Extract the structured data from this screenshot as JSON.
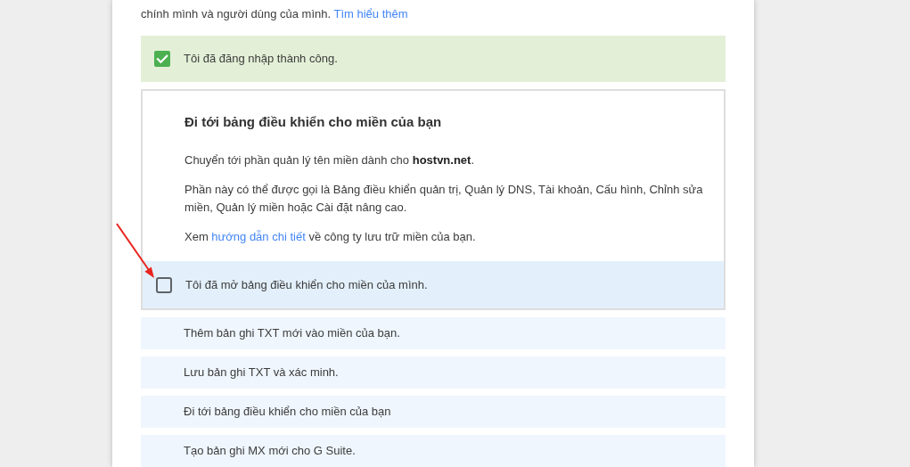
{
  "intro": {
    "text": "chính mình và người dùng của mình.",
    "link": "Tìm hiểu thêm"
  },
  "steps": [
    {
      "kind": "confirm",
      "label": "Tôi đã đăng nhập thành công.",
      "checked": true
    },
    {
      "kind": "expanded",
      "title": "Đi tới bảng điều khiển cho miền của bạn",
      "paragraphs": [
        {
          "text": "Chuyển tới phần quản lý tên miền dành cho **hostvn.net**."
        },
        {
          "text": "Phần này có thể được gọi là Bảng điều khiển quản trị, Quản lý DNS, Tài khoản, Cấu hình, Chỉnh sửa miền, Quản lý miền hoặc Cài đặt nâng cao."
        },
        {
          "text": "Xem",
          "link": "hướng dẫn chi tiết",
          "after": "về công ty lưu trữ miền của bạn."
        }
      ],
      "confirm": {
        "label": "Tôi đã mở bảng điều khiển cho miền của mình.",
        "checked": false
      }
    },
    {
      "kind": "collapsed",
      "label": "Thêm bản ghi TXT mới vào miền của bạn."
    },
    {
      "kind": "collapsed",
      "label": "Lưu bản ghi TXT và xác minh."
    },
    {
      "kind": "collapsed",
      "label": "Đi tới bảng điều khiển cho miền của bạn"
    },
    {
      "kind": "collapsed",
      "label": "Tạo bản ghi MX mới cho G Suite."
    }
  ],
  "annotation": {
    "kind": "arrow"
  }
}
